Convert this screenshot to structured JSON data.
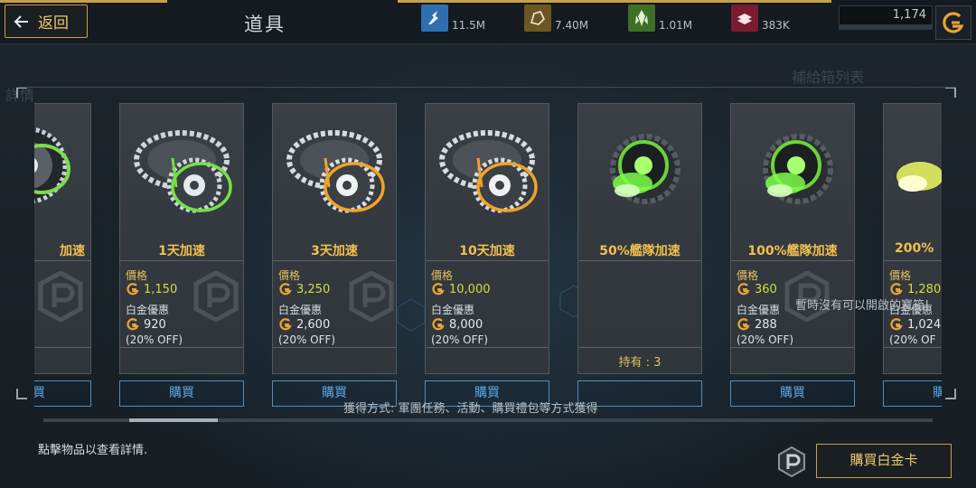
{
  "header": {
    "back_label": "返回",
    "title": "道具",
    "resources": [
      {
        "icon": "resource-crystal-icon",
        "value": "11.5M",
        "color": "#2f6fb0"
      },
      {
        "icon": "resource-ore-icon",
        "value": "7.40M",
        "color": "#8a6b2a"
      },
      {
        "icon": "resource-gem-icon",
        "value": "1.01M",
        "color": "#4c7d2e"
      },
      {
        "icon": "resource-alloy-icon",
        "value": "383K",
        "color": "#8a2038"
      }
    ],
    "gold_value": "1,174"
  },
  "labels": {
    "price": "價格",
    "platinum": "白金優惠",
    "buy": "購買"
  },
  "cards": [
    {
      "name": "加速",
      "type": "gear-green",
      "price": "",
      "plat_price": "",
      "off": "",
      "owned": ""
    },
    {
      "name": "1天加速",
      "type": "gear-green",
      "price": "1,150",
      "plat_price": "920",
      "off": "(20% OFF)",
      "owned": ""
    },
    {
      "name": "3天加速",
      "type": "gear-gold",
      "price": "3,250",
      "plat_price": "2,600",
      "off": "(20% OFF)",
      "owned": ""
    },
    {
      "name": "10天加速",
      "type": "gear-gold",
      "price": "10,000",
      "plat_price": "8,000",
      "off": "(20% OFF)",
      "owned": ""
    },
    {
      "name": "50%艦隊加速",
      "type": "thruster",
      "price": "",
      "plat_price": "",
      "off": "",
      "owned": "持有 : 3"
    },
    {
      "name": "100%艦隊加速",
      "type": "thruster",
      "price": "360",
      "plat_price": "288",
      "off": "(20% OFF)",
      "owned": ""
    },
    {
      "name": "200%",
      "type": "thruster-yellow",
      "price": "1,280",
      "plat_price": "1,024",
      "off": "(20% OF",
      "owned": ""
    }
  ],
  "overlay": {
    "no_box": "暫時沒有可以開啟的寶箱!",
    "obtain": "獲得方式: 軍團任務、活動、購買禮包等方式獲得",
    "ghost_supply": "補給箱列表",
    "ghost_detail": "詳情"
  },
  "footer": {
    "hint": "點擊物品以查看詳情.",
    "buy_platinum": "購買白金卡"
  }
}
